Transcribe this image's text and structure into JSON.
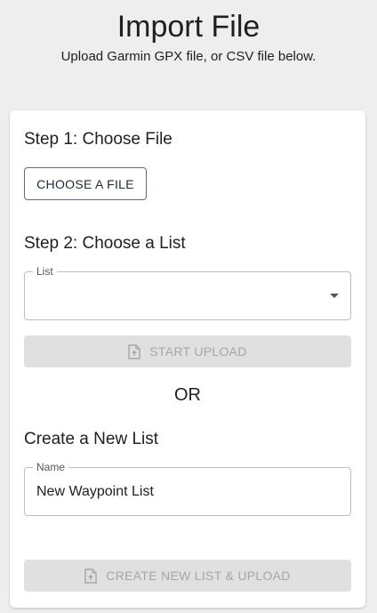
{
  "header": {
    "title": "Import File",
    "subtitle": "Upload Garmin GPX file, or CSV file below."
  },
  "step1": {
    "heading": "Step 1: Choose File",
    "button_label": "CHOOSE A FILE"
  },
  "step2": {
    "heading": "Step 2: Choose a List",
    "list_field_label": "List",
    "list_selected_value": "",
    "start_upload_label": "START UPLOAD"
  },
  "or_label": "OR",
  "new_list": {
    "heading": "Create a New List",
    "name_field_label": "Name",
    "name_value": "New Waypoint List",
    "create_button_label": "CREATE NEW LIST & UPLOAD"
  },
  "icons": {
    "upload": "file-upload-icon",
    "dropdown": "dropdown-caret-icon"
  },
  "colors": {
    "background": "#eeeeee",
    "card": "#ffffff",
    "disabled_button_bg": "#e0e0e0",
    "disabled_text": "#a6a6a6"
  }
}
